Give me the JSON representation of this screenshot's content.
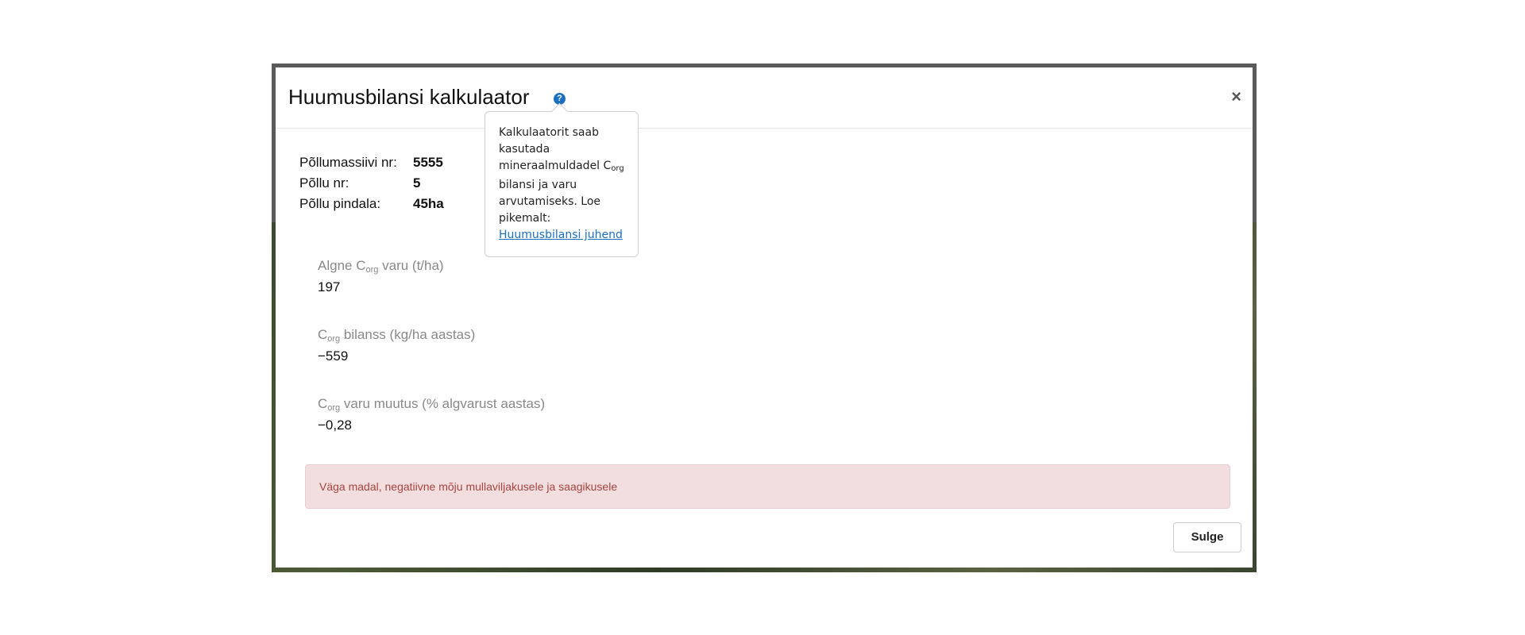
{
  "modal": {
    "title": "Huumusbilansi kalkulaator",
    "help_icon": "question-circle-icon",
    "close_icon": "close-icon",
    "close_symbol": "×"
  },
  "tooltip": {
    "line1": "Kalkulaatorit saab kasutada mineraalmuldadel C",
    "sub": "org",
    "line2": " bilansi ja varu arvutamiseks. Loe pikemalt: ",
    "link_text": "Huumusbilansi juhend"
  },
  "field_info": {
    "massif_label": "Põllumassiivi nr:",
    "massif_value": "5555",
    "field_label": "Põllu nr:",
    "field_value": "5",
    "area_label": "Põllu pindala:",
    "area_value": "45ha"
  },
  "metrics": {
    "initial_stock": {
      "label_pre": "Algne C",
      "label_sub": "org",
      "label_post": " varu (t/ha)",
      "value": "197"
    },
    "balance": {
      "label_pre": "C",
      "label_sub": "org",
      "label_post": " bilanss (kg/ha aastas)",
      "value": "−559"
    },
    "stock_change": {
      "label_pre": "C",
      "label_sub": "org",
      "label_post": " varu muutus (% algvarust aastas)",
      "value": "−0,28"
    }
  },
  "alert": {
    "text": "Väga madal, negatiivne mõju mullaviljakusele ja saagikusele",
    "color": "#a94442",
    "background": "#f2dede"
  },
  "footer": {
    "close_button_label": "Sulge"
  }
}
